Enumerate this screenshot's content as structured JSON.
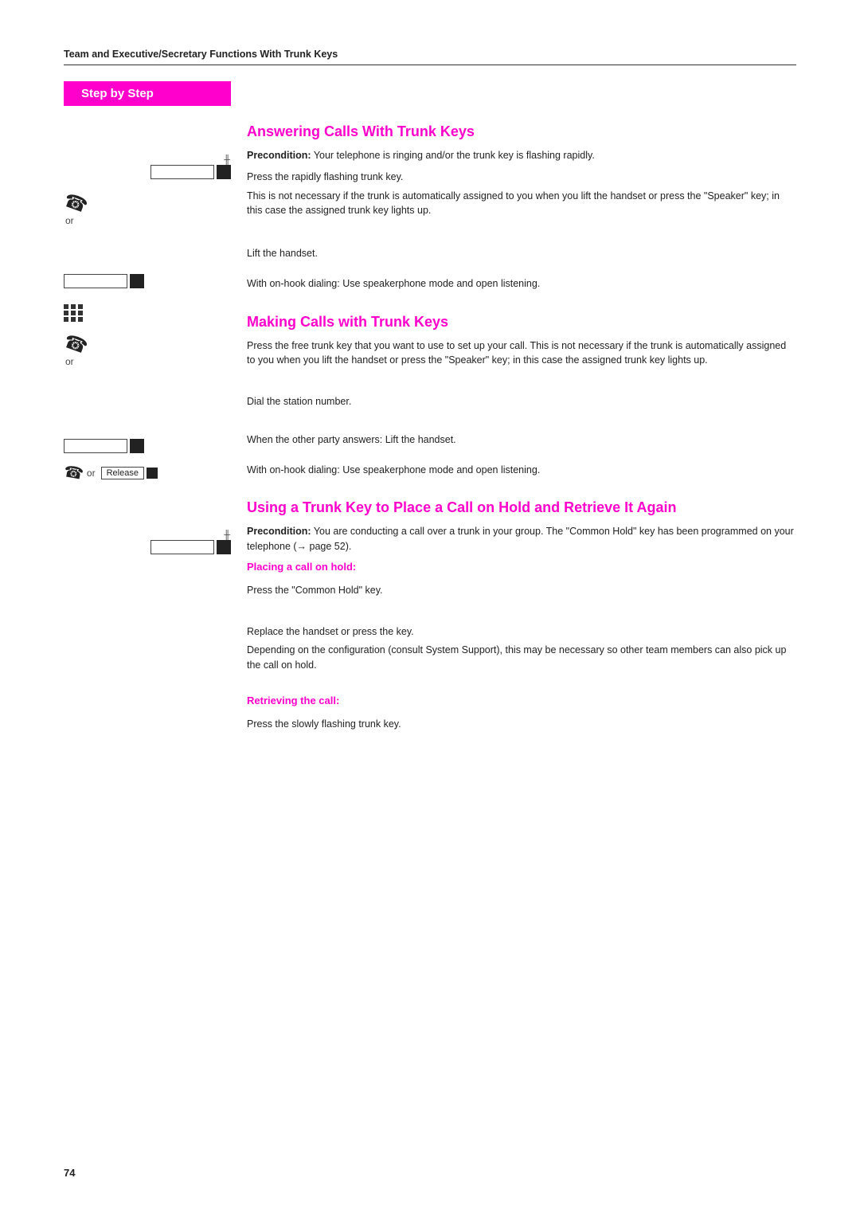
{
  "page": {
    "number": "74",
    "header": {
      "title": "Team and Executive/Secretary Functions With Trunk Keys"
    },
    "banner": "Step by Step",
    "sections": [
      {
        "id": "answering-calls",
        "title": "Answering Calls With Trunk Keys",
        "precondition": "Your telephone is ringing and/or the trunk key is flashing rapidly.",
        "instructions": [
          "Press the rapidly flashing trunk key.",
          "This is not necessary if the trunk is automatically assigned to you when you lift the handset or press the \"Speaker\" key; in this case the assigned trunk key lights up.",
          "Lift the handset.",
          "With on-hook dialing: Use speakerphone mode and open listening."
        ]
      },
      {
        "id": "making-calls",
        "title": "Making Calls with Trunk Keys",
        "instructions": [
          "Press the free trunk key that you want to use to set up your call. This is not necessary if the trunk is automatically assigned to you when you lift the handset or press the \"Speaker\" key; in this case the assigned trunk key lights up.",
          "Dial the station number.",
          "When the other party answers: Lift the handset.",
          "With on-hook dialing: Use speakerphone mode and open listening."
        ]
      },
      {
        "id": "hold-retrieve",
        "title": "Using a Trunk Key to Place a Call on Hold and Retrieve It Again",
        "precondition": "You are conducting a call over a trunk in your group. The \"Common Hold\" key has been programmed on your telephone (→ page 52).",
        "subsections": [
          {
            "id": "placing-hold",
            "title": "Placing a call on hold:",
            "instructions": [
              "Press the \"Common Hold\" key.",
              "Replace the handset or press the key.",
              "Depending on the configuration (consult System Support), this may be necessary so other team members can also pick up the call on hold."
            ]
          },
          {
            "id": "retrieving-call",
            "title": "Retrieving the call:",
            "instructions": [
              "Press the slowly flashing trunk key."
            ]
          }
        ]
      }
    ]
  }
}
